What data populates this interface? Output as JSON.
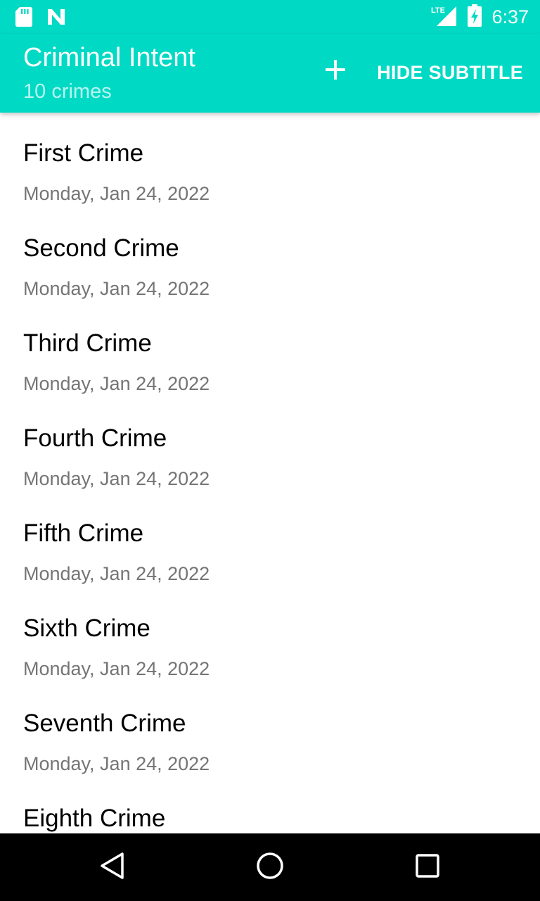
{
  "status_bar": {
    "time": "6:37",
    "network": "LTE",
    "icons": [
      "sd-card-icon",
      "n-notification-icon",
      "lte-signal-icon",
      "battery-charging-icon"
    ]
  },
  "app_bar": {
    "title": "Criminal Intent",
    "subtitle": "10 crimes",
    "add_icon": "plus-icon",
    "hide_subtitle_label": "HIDE SUBTITLE",
    "color": "#00d9c4"
  },
  "crimes": [
    {
      "title": "First Crime",
      "date": "Monday, Jan 24, 2022"
    },
    {
      "title": "Second Crime",
      "date": "Monday, Jan 24, 2022"
    },
    {
      "title": "Third Crime",
      "date": "Monday, Jan 24, 2022"
    },
    {
      "title": "Fourth Crime",
      "date": "Monday, Jan 24, 2022"
    },
    {
      "title": "Fifth Crime",
      "date": "Monday, Jan 24, 2022"
    },
    {
      "title": "Sixth Crime",
      "date": "Monday, Jan 24, 2022"
    },
    {
      "title": "Seventh Crime",
      "date": "Monday, Jan 24, 2022"
    },
    {
      "title": "Eighth Crime"
    }
  ],
  "nav_bar": {
    "icons": [
      "back-icon",
      "home-icon",
      "recents-icon"
    ]
  }
}
